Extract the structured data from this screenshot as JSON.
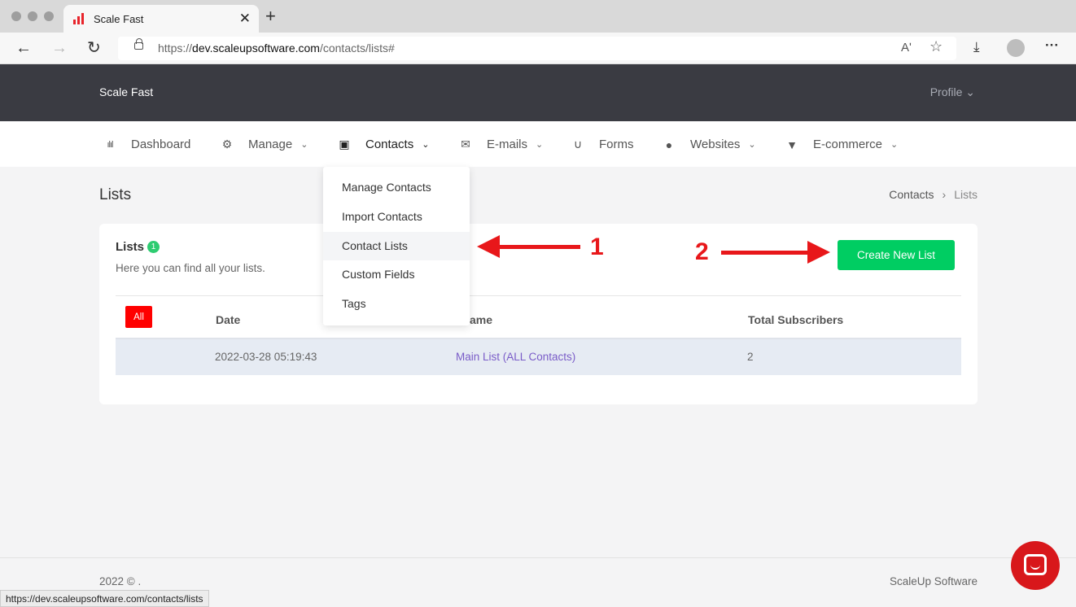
{
  "browser": {
    "tab_title": "Scale Fast",
    "tab_close": "✕",
    "new_tab": "+",
    "url_prefix": "https://",
    "url_domain": "dev.scaleupsoftware.com",
    "url_path": "/contacts/lists#",
    "back_icon": "←",
    "forward_icon": "→",
    "reload_icon": "↻",
    "read_aloud_icon": "Aʹ",
    "favorites_icon": "☆",
    "downloads_icon": "⤓",
    "more_icon": "···",
    "status_url": "https://dev.scaleupsoftware.com/contacts/lists"
  },
  "header": {
    "brand": "Scale Fast",
    "profile": "Profile ⌄"
  },
  "menu": {
    "dashboard": "Dashboard",
    "manage": "Manage",
    "contacts": "Contacts",
    "emails": "E-mails",
    "forms": "Forms",
    "websites": "Websites",
    "ecommerce": "E-commerce",
    "chevron": "⌄"
  },
  "dropdown": {
    "items": [
      "Manage Contacts",
      "Import Contacts",
      "Contact Lists",
      "Custom Fields",
      "Tags"
    ]
  },
  "page": {
    "title": "Lists",
    "breadcrumb_parent": "Contacts",
    "breadcrumb_sep": "›",
    "breadcrumb_current": "Lists"
  },
  "card": {
    "title": "Lists",
    "count": "1",
    "subtitle": "Here you can find all your lists.",
    "create_button": "Create New List",
    "filter_all": "All",
    "columns": [
      "Date",
      "Name",
      "Total Subscribers"
    ],
    "name_header_visible": "ame",
    "rows": [
      {
        "date": "2022-03-28 05:19:43",
        "name": "Main List (ALL Contacts)",
        "subscribers": "2"
      }
    ]
  },
  "annotations": {
    "one": "1",
    "two": "2"
  },
  "footer": {
    "copyright": "2022 © .",
    "company": "ScaleUp Software"
  },
  "colors": {
    "accent_green": "#00cd62",
    "header_dark": "#3a3b42",
    "annotation_red": "#e8171a",
    "link_purple": "#7a5cc8"
  }
}
